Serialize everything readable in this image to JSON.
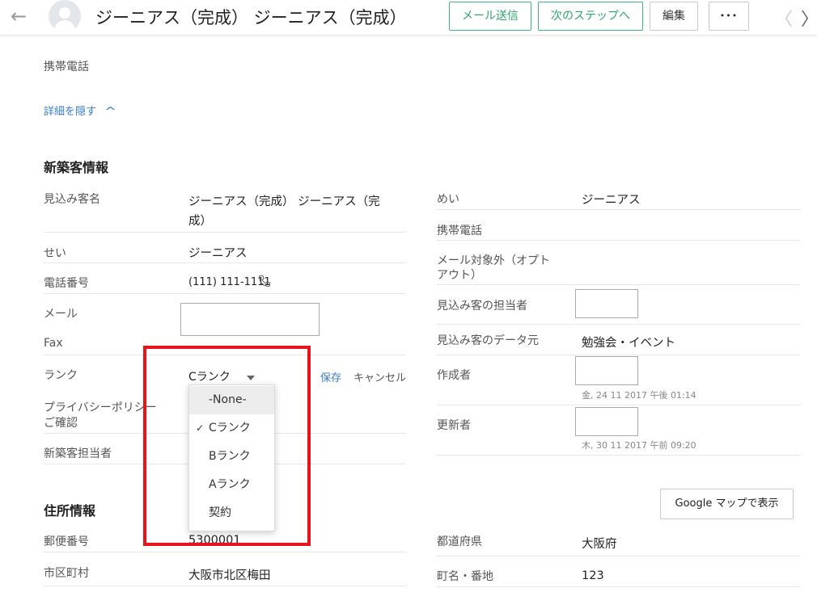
{
  "header": {
    "title": "ジーニアス（完成） ジーニアス（完成）",
    "btn_send_mail": "メール送信",
    "btn_next_step": "次のステップへ",
    "btn_edit": "編集",
    "btn_more": "•••",
    "back_icon": "←",
    "prev_icon": "〈",
    "next_icon": "〉"
  },
  "top": {
    "mobile_label": "携帯電話",
    "hide_details": "詳細を隠す",
    "hide_icon": "^"
  },
  "lead_info": {
    "section_title": "新築客情報",
    "left": {
      "lead_name_label": "見込み客名",
      "lead_name_line1": "ジーニアス（完成） ジーニアス（完",
      "lead_name_line2": "成）",
      "last_name_label": "せい",
      "last_name_value": "ジーニアス",
      "phone_label": "電話番号",
      "phone_value": "(111) 111-1111",
      "email_label": "メール",
      "fax_label": "Fax",
      "rank_label": "ランク",
      "rank_selected": "Cランク",
      "save": "保存",
      "cancel": "キャンセル",
      "privacy_label_line1": "プライバシーポリシー",
      "privacy_label_line2": "ご確認",
      "owner_label": "新築客担当者"
    },
    "rank_options": [
      {
        "label": "-None-",
        "checked": false
      },
      {
        "label": "Cランク",
        "checked": true
      },
      {
        "label": "Bランク",
        "checked": false
      },
      {
        "label": "Aランク",
        "checked": false
      },
      {
        "label": "契約",
        "checked": false
      }
    ],
    "right": {
      "first_name_label": "めい",
      "first_name_value": "ジーニアス",
      "mobile_label": "携帯電話",
      "optout_label_line1": "メール対象外（オプト",
      "optout_label_line2": "アウト）",
      "lead_owner_label": "見込み客の担当者",
      "lead_source_label": "見込み客のデータ元",
      "lead_source_value": "勉強会・イベント",
      "created_by_label": "作成者",
      "created_time": "金, 24 11 2017 午後 01:14",
      "modified_by_label": "更新者",
      "modified_time": "木, 30 11 2017 午前 09:20"
    }
  },
  "address": {
    "section_title": "住所情報",
    "google_map": "Google マップで表示",
    "zip_label": "郵便番号",
    "zip_value": "5300001",
    "city_label": "市区町村",
    "city_value": "大阪市北区梅田",
    "pref_label": "都道府県",
    "pref_value": "大阪府",
    "street_label": "町名・番地",
    "street_value": "123"
  },
  "colors": {
    "accent_green": "#3bb77e",
    "link_blue": "#3a7dc9",
    "highlight_red": "#e8141c"
  }
}
